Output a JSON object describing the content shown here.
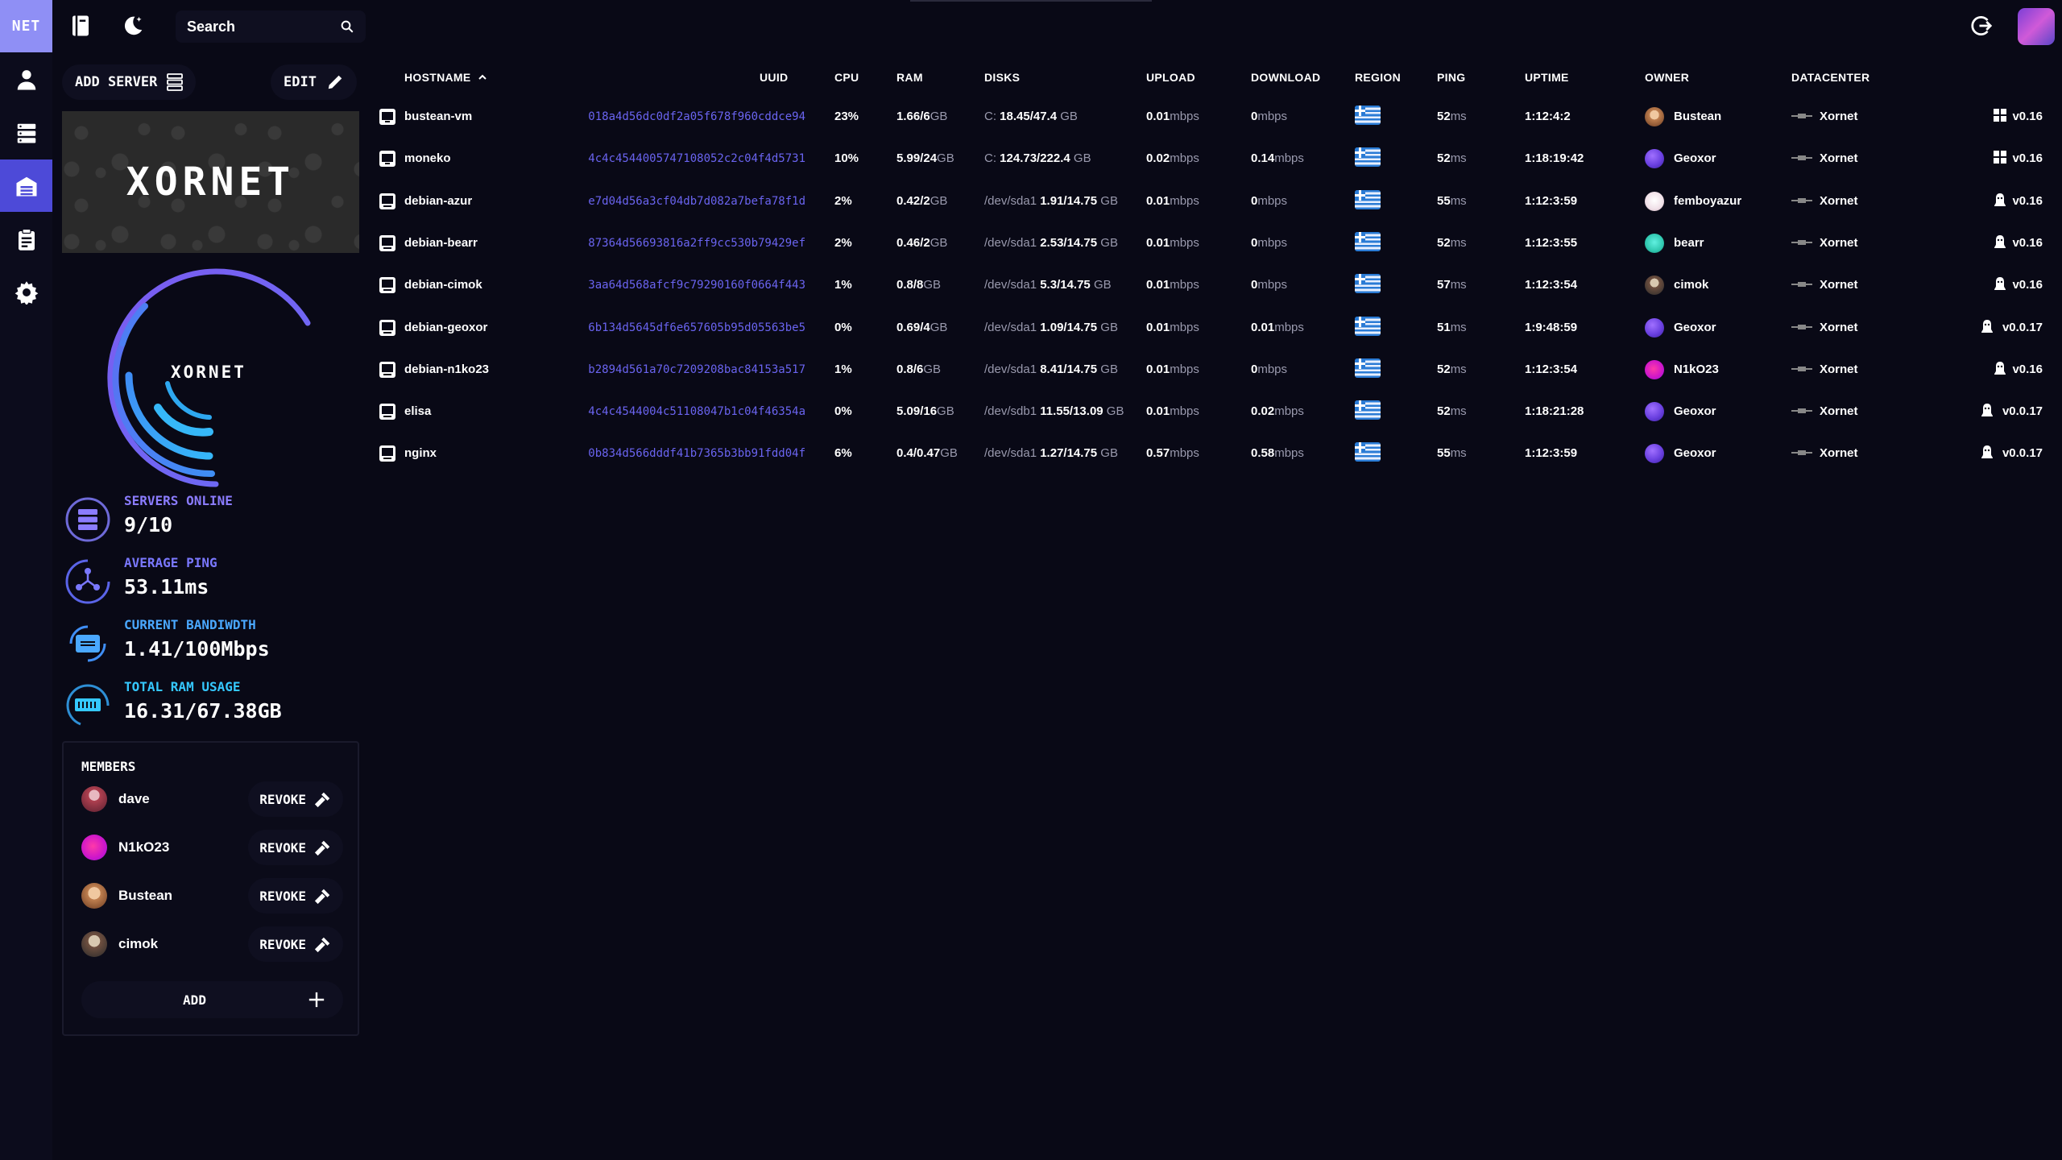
{
  "app": {
    "logo_text": "NET"
  },
  "search": {
    "placeholder": "Search"
  },
  "left": {
    "add_server": "ADD SERVER",
    "edit": "EDIT",
    "banner_text": "XORNET",
    "gauge_label": "XORNET",
    "stats": [
      {
        "label": "SERVERS ONLINE",
        "value": "9/10",
        "color": "#8b7cff"
      },
      {
        "label": "AVERAGE PING",
        "value": "53.11ms",
        "color": "#7a78ff"
      },
      {
        "label": "CURRENT BANDIWDTH",
        "value": "1.41/100Mbps",
        "color": "#4aa8ff"
      },
      {
        "label": "TOTAL RAM USAGE",
        "value": "16.31/67.38GB",
        "color": "#35c8ff"
      }
    ]
  },
  "members": {
    "title": "MEMBERS",
    "revoke_label": "REVOKE",
    "add_label": "ADD",
    "list": [
      {
        "name": "dave"
      },
      {
        "name": "N1kO23"
      },
      {
        "name": "Bustean"
      },
      {
        "name": "cimok"
      }
    ]
  },
  "table": {
    "headers": {
      "hostname": "HOSTNAME",
      "uuid": "UUID",
      "cpu": "CPU",
      "ram": "RAM",
      "disks": "DISKS",
      "upload": "UPLOAD",
      "download": "DOWNLOAD",
      "region": "REGION",
      "ping": "PING",
      "uptime": "UPTIME",
      "owner": "OWNER",
      "datacenter": "DATACENTER"
    },
    "rows": [
      {
        "hostname": "bustean-vm",
        "uuid": "018a4d56dc0df2a05f678f960cddce94",
        "cpu": "23%",
        "ram_used": "1.66/6",
        "ram_unit": "GB",
        "disk_name": "C:",
        "disk_usage": "18.45/47.4",
        "disk_unit": "GB",
        "upload_val": "0.01",
        "upload_unit": "mbps",
        "download_val": "0",
        "download_unit": "mbps",
        "ping_val": "52",
        "ping_unit": "ms",
        "uptime": "1:12:4:2",
        "owner": "Bustean",
        "datacenter": "Xornet",
        "version": "v0.16"
      },
      {
        "hostname": "moneko",
        "uuid": "4c4c4544005747108052c2c04f4d5731",
        "cpu": "10%",
        "ram_used": "5.99/24",
        "ram_unit": "GB",
        "disk_name": "C:",
        "disk_usage": "124.73/222.4",
        "disk_unit": "GB",
        "upload_val": "0.02",
        "upload_unit": "mbps",
        "download_val": "0.14",
        "download_unit": "mbps",
        "ping_val": "52",
        "ping_unit": "ms",
        "uptime": "1:18:19:42",
        "owner": "Geoxor",
        "datacenter": "Xornet",
        "version": "v0.16"
      },
      {
        "hostname": "debian-azur",
        "uuid": "e7d04d56a3cf04db7d082a7befa78f1d",
        "cpu": "2%",
        "ram_used": "0.42/2",
        "ram_unit": "GB",
        "disk_name": "/dev/sda1",
        "disk_usage": "1.91/14.75",
        "disk_unit": "GB",
        "upload_val": "0.01",
        "upload_unit": "mbps",
        "download_val": "0",
        "download_unit": "mbps",
        "ping_val": "55",
        "ping_unit": "ms",
        "uptime": "1:12:3:59",
        "owner": "femboyazur",
        "datacenter": "Xornet",
        "version": "v0.16"
      },
      {
        "hostname": "debian-bearr",
        "uuid": "87364d56693816a2ff9cc530b79429ef",
        "cpu": "2%",
        "ram_used": "0.46/2",
        "ram_unit": "GB",
        "disk_name": "/dev/sda1",
        "disk_usage": "2.53/14.75",
        "disk_unit": "GB",
        "upload_val": "0.01",
        "upload_unit": "mbps",
        "download_val": "0",
        "download_unit": "mbps",
        "ping_val": "52",
        "ping_unit": "ms",
        "uptime": "1:12:3:55",
        "owner": "bearr",
        "datacenter": "Xornet",
        "version": "v0.16"
      },
      {
        "hostname": "debian-cimok",
        "uuid": "3aa64d568afcf9c79290160f0664f443",
        "cpu": "1%",
        "ram_used": "0.8/8",
        "ram_unit": "GB",
        "disk_name": "/dev/sda1",
        "disk_usage": "5.3/14.75",
        "disk_unit": "GB",
        "upload_val": "0.01",
        "upload_unit": "mbps",
        "download_val": "0",
        "download_unit": "mbps",
        "ping_val": "57",
        "ping_unit": "ms",
        "uptime": "1:12:3:54",
        "owner": "cimok",
        "datacenter": "Xornet",
        "version": "v0.16"
      },
      {
        "hostname": "debian-geoxor",
        "uuid": "6b134d5645df6e657605b95d05563be5",
        "cpu": "0%",
        "ram_used": "0.69/4",
        "ram_unit": "GB",
        "disk_name": "/dev/sda1",
        "disk_usage": "1.09/14.75",
        "disk_unit": "GB",
        "upload_val": "0.01",
        "upload_unit": "mbps",
        "download_val": "0.01",
        "download_unit": "mbps",
        "ping_val": "51",
        "ping_unit": "ms",
        "uptime": "1:9:48:59",
        "owner": "Geoxor",
        "datacenter": "Xornet",
        "version": "v0.0.17"
      },
      {
        "hostname": "debian-n1ko23",
        "uuid": "b2894d561a70c7209208bac84153a517",
        "cpu": "1%",
        "ram_used": "0.8/6",
        "ram_unit": "GB",
        "disk_name": "/dev/sda1",
        "disk_usage": "8.41/14.75",
        "disk_unit": "GB",
        "upload_val": "0.01",
        "upload_unit": "mbps",
        "download_val": "0",
        "download_unit": "mbps",
        "ping_val": "52",
        "ping_unit": "ms",
        "uptime": "1:12:3:54",
        "owner": "N1kO23",
        "datacenter": "Xornet",
        "version": "v0.16"
      },
      {
        "hostname": "elisa",
        "uuid": "4c4c4544004c51108047b1c04f46354a",
        "cpu": "0%",
        "ram_used": "5.09/16",
        "ram_unit": "GB",
        "disk_name": "/dev/sdb1",
        "disk_usage": "11.55/13.09",
        "disk_unit": "GB",
        "upload_val": "0.01",
        "upload_unit": "mbps",
        "download_val": "0.02",
        "download_unit": "mbps",
        "ping_val": "52",
        "ping_unit": "ms",
        "uptime": "1:18:21:28",
        "owner": "Geoxor",
        "datacenter": "Xornet",
        "version": "v0.0.17"
      },
      {
        "hostname": "nginx",
        "uuid": "0b834d566dddf41b7365b3bb91fdd04f",
        "cpu": "6%",
        "ram_used": "0.4/0.47",
        "ram_unit": "GB",
        "disk_name": "/dev/sda1",
        "disk_usage": "1.27/14.75",
        "disk_unit": "GB",
        "upload_val": "0.57",
        "upload_unit": "mbps",
        "download_val": "0.58",
        "download_unit": "mbps",
        "ping_val": "55",
        "ping_unit": "ms",
        "uptime": "1:12:3:59",
        "owner": "Geoxor",
        "datacenter": "Xornet",
        "version": "v0.0.17"
      }
    ]
  }
}
